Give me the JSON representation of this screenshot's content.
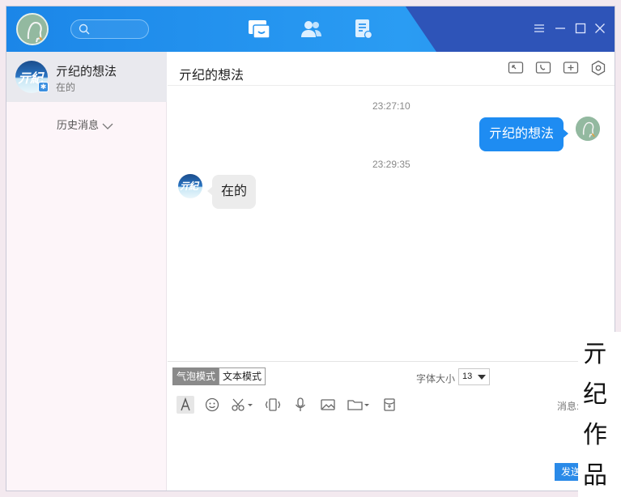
{
  "topbar": {
    "search_placeholder": "",
    "nav": [
      "messages",
      "contacts",
      "apps"
    ]
  },
  "sidebar": {
    "conversation": {
      "name": "亓纪的想法",
      "last_message": "在的"
    },
    "history_label": "历史消息"
  },
  "chat": {
    "title": "亓纪的想法",
    "messages": [
      {
        "time": "23:27:10",
        "direction": "out",
        "text": "亓纪的想法"
      },
      {
        "time": "23:29:35",
        "direction": "in",
        "text": "在的"
      }
    ]
  },
  "composer": {
    "mode_bubble": "气泡模式",
    "mode_text": "文本模式",
    "font_size_label": "字体大小",
    "font_size_value": "13",
    "history_label": "消息:",
    "send_label": "发送"
  },
  "watermark": {
    "chars": [
      "亓",
      "纪",
      "作",
      "品"
    ]
  },
  "colors": {
    "accent": "#1e8cf2",
    "topbar": "#1b86e8",
    "topbar_dark": "#2e54b8",
    "sidebar_bg": "#fdf5f9"
  }
}
